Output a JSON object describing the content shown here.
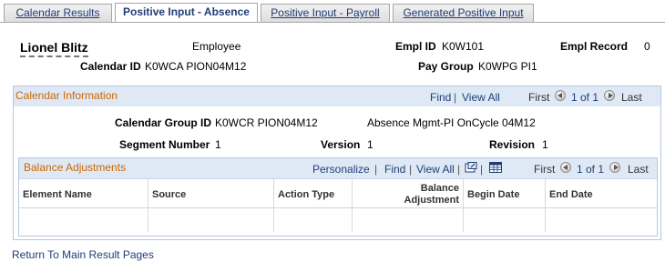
{
  "tabs": [
    {
      "label": "Calendar Results",
      "active": false
    },
    {
      "label": "Positive Input - Absence",
      "active": true
    },
    {
      "label": "Positive Input - Payroll",
      "active": false
    },
    {
      "label": "Generated Positive Input",
      "active": false
    }
  ],
  "employee": {
    "name": "Lionel Blitz",
    "type": "Employee",
    "empl_id_label": "Empl ID",
    "empl_id": "K0W101",
    "empl_record_label": "Empl Record",
    "empl_record": "0",
    "calendar_id_label": "Calendar ID",
    "calendar_id": "K0WCA PION04M12",
    "pay_group_label": "Pay Group",
    "pay_group": "K0WPG PI1"
  },
  "calendar_info": {
    "title": "Calendar Information",
    "find": "Find",
    "sep": "|",
    "view_all": "View All",
    "first": "First",
    "range": "1 of 1",
    "last": "Last",
    "group_id_label": "Calendar Group ID",
    "group_id": "K0WCR PION04M12",
    "group_desc": "Absence Mgmt-PI OnCycle 04M12",
    "segment_label": "Segment Number",
    "segment": "1",
    "version_label": "Version",
    "version": "1",
    "revision_label": "Revision",
    "revision": "1"
  },
  "balance": {
    "title": "Balance Adjustments",
    "personalize": "Personalize",
    "find": "Find",
    "view_all": "View All",
    "first": "First",
    "range": "1 of 1",
    "last": "Last",
    "columns": [
      "Element Name",
      "Source",
      "Action Type",
      "Balance Adjustment",
      "Begin Date",
      "End Date"
    ]
  },
  "footer": {
    "return_link": "Return To Main Result Pages"
  },
  "colors": {
    "link": "#1f3d77",
    "section_title": "#cc6600",
    "header_bg": "#dfe9f5",
    "border": "#b5c7dd"
  }
}
